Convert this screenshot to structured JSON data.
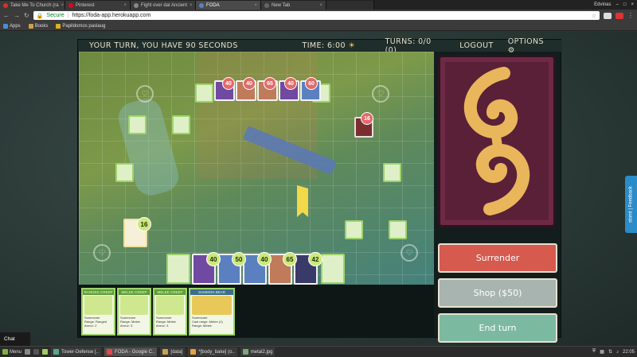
{
  "browser": {
    "tabs": [
      {
        "title": "Take Me To Church (ra",
        "color": "#d93025"
      },
      {
        "title": "Pinterest",
        "color": "#e60023"
      },
      {
        "title": "Fight over dat Ancient",
        "color": "#888888"
      },
      {
        "title": "FODA",
        "color": "#5b80c0",
        "active": true
      },
      {
        "title": "New Tab",
        "color": "#666666"
      }
    ],
    "user": "Edvinas",
    "secure_label": "Secure",
    "url": "https://foda-app.herokuapp.com",
    "bookmarks": [
      "Apps",
      "Books",
      "Papildomos paslaug"
    ]
  },
  "hud": {
    "turn_message": "YOUR TURN, YOU HAVE 90 SECONDS",
    "time": "TIME: 6:00",
    "turns": "TURNS: 0/0 (0)",
    "logout": "LOGOUT",
    "options": "OPTIONS"
  },
  "board": {
    "enemy_badges": [
      "40",
      "40",
      "65",
      "40",
      "60"
    ],
    "enemy_tower_badge": "16",
    "own_tower_badge": "16",
    "ally_badges": [
      "40",
      "50",
      "40",
      "65",
      "42"
    ]
  },
  "hand": [
    {
      "name": "RANGED CREEP",
      "role": "Summoner",
      "line2": "Range: Ranged",
      "line3": "Armor: 2"
    },
    {
      "name": "MELEE CREEP",
      "role": "Summoner",
      "line2": "Range: Melee",
      "line3": "Armor: 3"
    },
    {
      "name": "MELEE CREEP",
      "role": "Summoner",
      "line2": "Range: Melee",
      "line3": "Armor: 3"
    },
    {
      "name": "SUMMON BEAR",
      "role": "Summoner",
      "line2": "Cast range: Melee (1)",
      "line3": "Range: Melee"
    }
  ],
  "actions": {
    "surrender": "Surrender",
    "shop": "Shop ($50)",
    "end_turn": "End turn"
  },
  "feedback_label": "stomt | Feedback",
  "chat_label": "Chat",
  "taskbar": {
    "menu": "Menu",
    "tasks": [
      "Tower-Defense [..",
      "FODA - Google C..",
      "[data]",
      "*[body_bake] (o..",
      "metal2.jpg"
    ],
    "clock": "22:05"
  },
  "colors": {
    "surrender": "#d65a4e",
    "shop": "#a8b4b0",
    "end_turn": "#7cb9a1",
    "card_back": "#5a2038",
    "hp_badge": "#cde87a",
    "enemy_badge": "#e26a6a"
  }
}
